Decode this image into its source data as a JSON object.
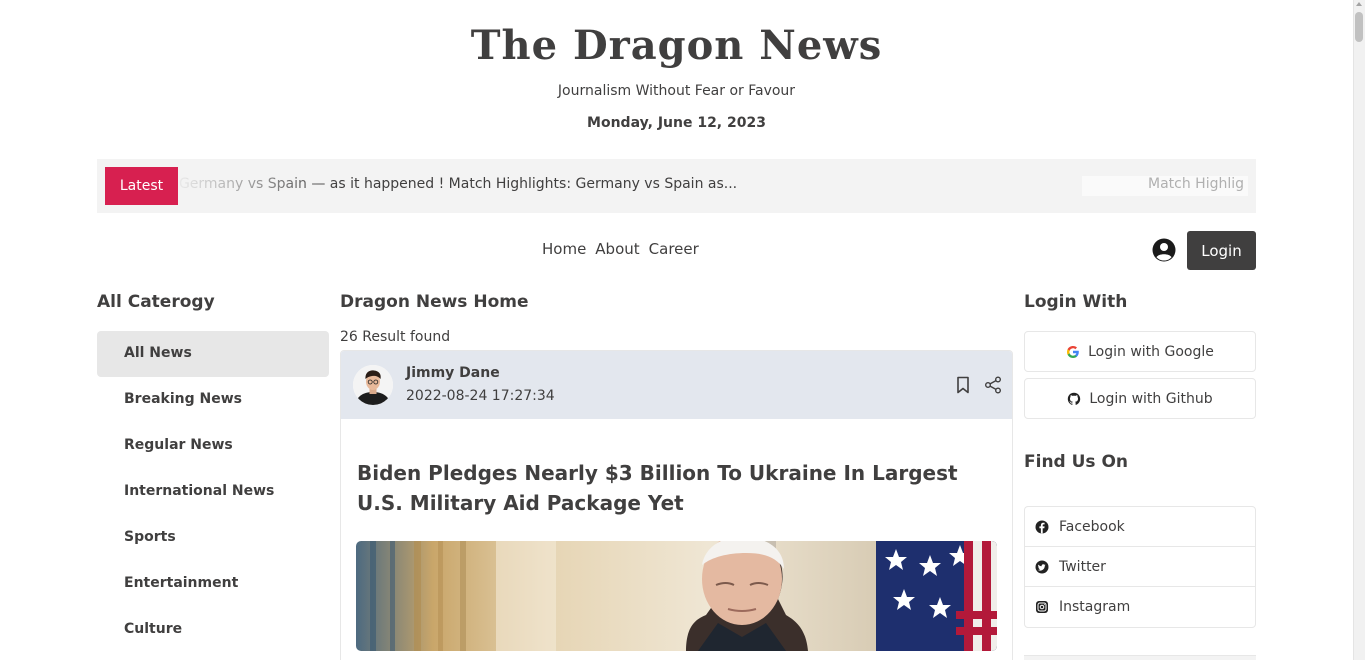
{
  "header": {
    "site_title": "The Dragon News",
    "tagline": "Journalism Without Fear or Favour",
    "date": "Monday, June 12, 2023"
  },
  "ticker": {
    "badge_label": "Latest",
    "marquee_text": "ts: Germany vs Spain — as it happened ! Match Highlights: Germany vs Spain as...",
    "marquee_tail": "Match Highlig"
  },
  "nav": {
    "items": [
      {
        "label": "Home"
      },
      {
        "label": "About"
      },
      {
        "label": "Career"
      }
    ],
    "login_label": "Login",
    "user_icon": "user-circle-icon"
  },
  "left_sidebar": {
    "title": "All Caterogy",
    "categories": [
      {
        "label": "All News",
        "active": true
      },
      {
        "label": "Breaking News",
        "active": false
      },
      {
        "label": "Regular News",
        "active": false
      },
      {
        "label": "International News",
        "active": false
      },
      {
        "label": "Sports",
        "active": false
      },
      {
        "label": "Entertainment",
        "active": false
      },
      {
        "label": "Culture",
        "active": false
      }
    ]
  },
  "main": {
    "title": "Dragon News Home",
    "result_count": "26 Result found",
    "card": {
      "author": "Jimmy Dane",
      "published": "2022-08-24 17:27:34",
      "headline": "Biden Pledges Nearly $3 Billion To Ukraine In Largest U.S. Military Aid Package Yet",
      "icons": [
        "bookmark-icon",
        "share-icon"
      ]
    }
  },
  "right_sidebar": {
    "login_title": "Login With",
    "google_label": "Login with Google",
    "github_label": "Login with Github",
    "find_title": "Find Us On",
    "socials": [
      {
        "label": "Facebook",
        "icon": "facebook-icon"
      },
      {
        "label": "Twitter",
        "icon": "twitter-icon"
      },
      {
        "label": "Instagram",
        "icon": "instagram-icon"
      }
    ]
  },
  "colors": {
    "accent": "#d72050",
    "dark": "#403f3f",
    "ticker_bg": "#f3f3f3",
    "card_head_bg": "#e3e7ee"
  }
}
